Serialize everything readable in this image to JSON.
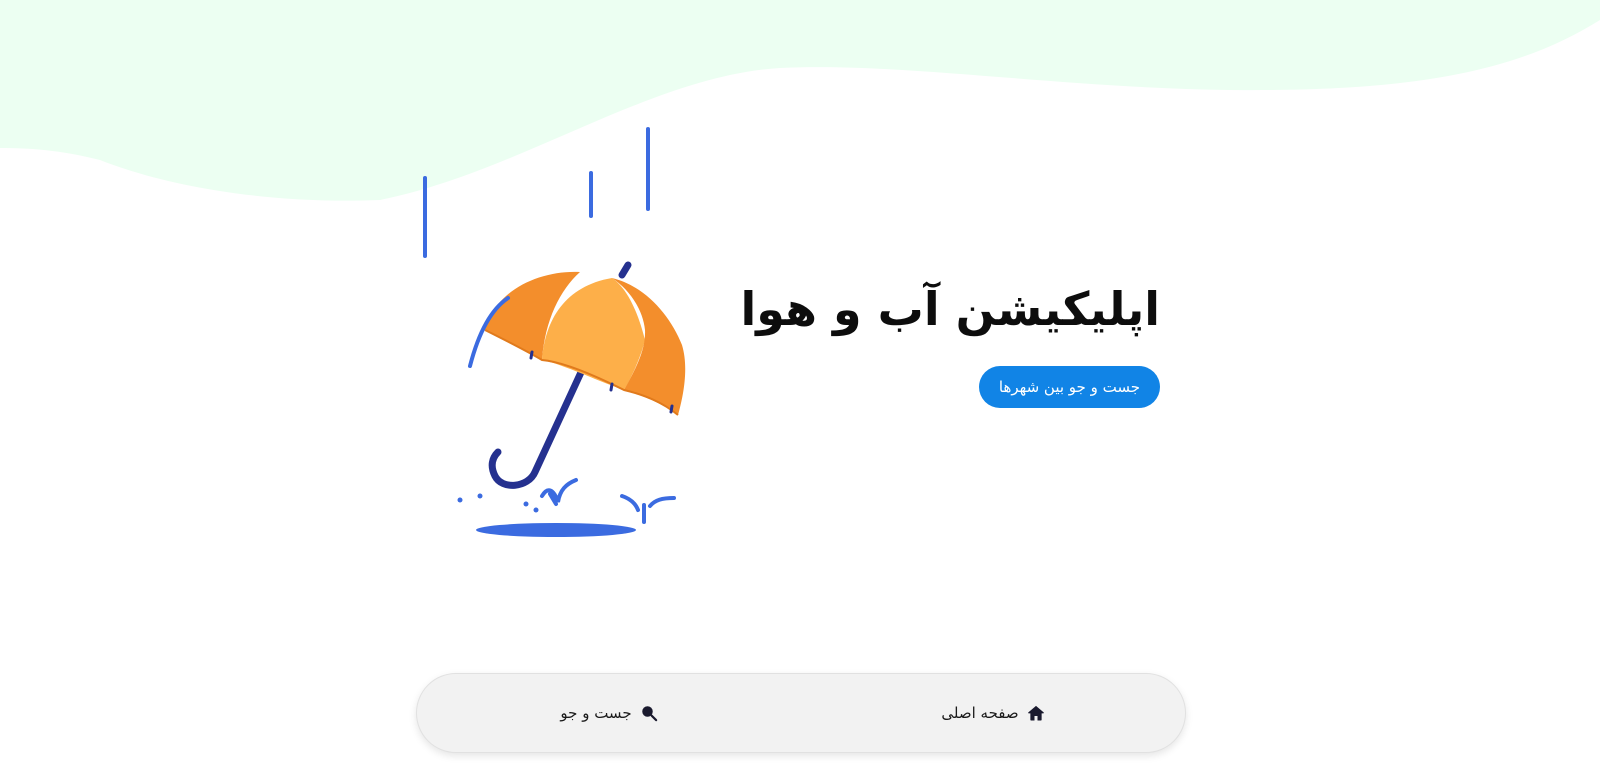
{
  "hero": {
    "title": "اپلیکیشن آب و هوا",
    "search_button_label": "جست و جو بین شهرها"
  },
  "bottom_nav": {
    "items": [
      {
        "label": "صفحه اصلی",
        "icon": "home-icon"
      },
      {
        "label": "جست و جو",
        "icon": "search-icon"
      }
    ]
  },
  "colors": {
    "wave_background": "#ecfff2",
    "accent": "#1184e6",
    "umbrella_orange": "#f38e2c",
    "umbrella_light": "#fdaf49",
    "rain_blue": "#3b6be0",
    "handle_navy": "#25318f"
  }
}
